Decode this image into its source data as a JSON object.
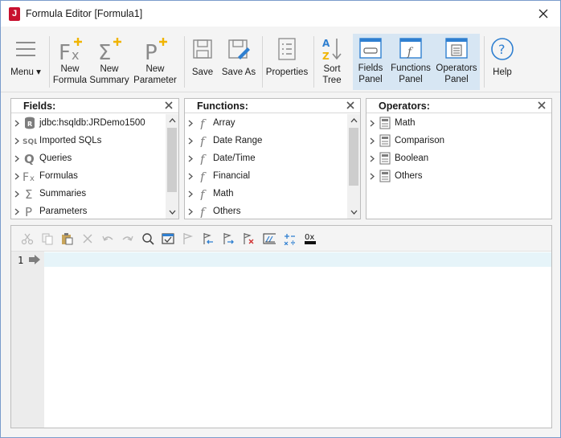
{
  "window": {
    "title": "Formula Editor [Formula1]",
    "app_icon": "J"
  },
  "toolbar": {
    "menu": "Menu",
    "new_formula": [
      "New",
      "Formula"
    ],
    "new_summary": [
      "New",
      "Summary"
    ],
    "new_parameter": [
      "New",
      "Parameter"
    ],
    "save": "Save",
    "save_as": "Save As",
    "properties": "Properties",
    "sort_tree": [
      "Sort",
      "Tree"
    ],
    "fields_panel": [
      "Fields",
      "Panel"
    ],
    "functions_panel": [
      "Functions",
      "Panel"
    ],
    "operators_panel": [
      "Operators",
      "Panel"
    ],
    "help": "Help"
  },
  "fields": {
    "title": "Fields:",
    "items": [
      {
        "label": "jdbc:hsqldb:JRDemo1500",
        "icon": "database-icon"
      },
      {
        "label": "Imported SQLs",
        "icon": "sql-icon"
      },
      {
        "label": "Queries",
        "icon": "query-icon"
      },
      {
        "label": "Formulas",
        "icon": "formula-icon"
      },
      {
        "label": "Summaries",
        "icon": "summary-icon"
      },
      {
        "label": "Parameters",
        "icon": "parameter-icon"
      }
    ]
  },
  "functions": {
    "title": "Functions:",
    "items": [
      {
        "label": "Array"
      },
      {
        "label": "Date Range"
      },
      {
        "label": "Date/Time"
      },
      {
        "label": "Financial"
      },
      {
        "label": "Math"
      },
      {
        "label": "Others"
      }
    ]
  },
  "operators": {
    "title": "Operators:",
    "items": [
      {
        "label": "Math"
      },
      {
        "label": "Comparison"
      },
      {
        "label": "Boolean"
      },
      {
        "label": "Others"
      }
    ]
  },
  "editor": {
    "line_number": "1",
    "hex_label": "0x"
  },
  "colors": {
    "accent": "#2f7fd0",
    "active_toggle": "#d7e6f3",
    "plus": "#f0b400"
  }
}
